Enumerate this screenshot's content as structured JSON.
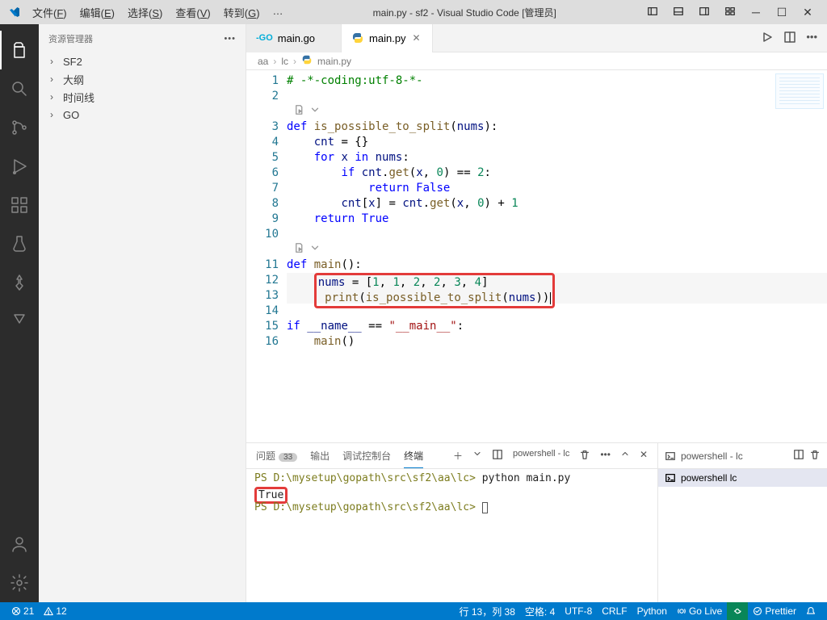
{
  "titlebar": {
    "menus": [
      "文件(F)",
      "编辑(E)",
      "选择(S)",
      "查看(V)",
      "转到(G)"
    ],
    "title": "main.py - sf2 - Visual Studio Code [管理员]"
  },
  "sidebar": {
    "title": "资源管理器",
    "items": [
      "SF2",
      "大纲",
      "时间线",
      "GO"
    ]
  },
  "tabs": [
    {
      "icon": "go",
      "label": "main.go",
      "active": false
    },
    {
      "icon": "py",
      "label": "main.py",
      "active": true
    }
  ],
  "breadcrumb": [
    "aa",
    "lc",
    "main.py"
  ],
  "code": {
    "lines": [
      {
        "n": 1,
        "html": "<span class='cm'># -*-coding:utf-8-*-</span>"
      },
      {
        "n": 2,
        "html": ""
      },
      {
        "n": "",
        "html": "<span class='lens'><svg viewBox='0 0 16 16'><path d='M2 2h6l2 2v10H2z'/><path d='M6 8l3 2-3 2z' fill='currentColor'/></svg><svg viewBox='0 0 16 16'><path d='M4 6l4 4 4-4'/></svg></span>"
      },
      {
        "n": 3,
        "html": "<span class='kw'>def</span> <span class='fn'>is_possible_to_split</span>(<span class='vr'>nums</span>):"
      },
      {
        "n": 4,
        "html": "    <span class='vr'>cnt</span> = {}"
      },
      {
        "n": 5,
        "html": "    <span class='kw'>for</span> <span class='vr'>x</span> <span class='kw'>in</span> <span class='vr'>nums</span>:"
      },
      {
        "n": 6,
        "html": "        <span class='kw'>if</span> <span class='vr'>cnt</span>.<span class='fn'>get</span>(<span class='vr'>x</span>, <span class='num'>0</span>) == <span class='num'>2</span>:"
      },
      {
        "n": 7,
        "html": "            <span class='kw'>return</span> <span class='cn'>False</span>"
      },
      {
        "n": 8,
        "html": "        <span class='vr'>cnt</span>[<span class='vr'>x</span>] = <span class='vr'>cnt</span>.<span class='fn'>get</span>(<span class='vr'>x</span>, <span class='num'>0</span>) + <span class='num'>1</span>"
      },
      {
        "n": 9,
        "html": "    <span class='kw'>return</span> <span class='cn'>True</span>"
      },
      {
        "n": 10,
        "html": ""
      },
      {
        "n": "",
        "html": "<span class='lens'><svg viewBox='0 0 16 16'><path d='M2 2h6l2 2v10H2z'/><path d='M6 8l3 2-3 2z' fill='currentColor'/></svg><svg viewBox='0 0 16 16'><path d='M4 6l4 4 4-4'/></svg></span>"
      },
      {
        "n": 11,
        "html": "<span class='kw'>def</span> <span class='fn'>main</span>():"
      },
      {
        "n": 12,
        "html": "    <span class='redbox'><span class='vr'>nums</span> = [<span class='num'>1</span>, <span class='num'>1</span>, <span class='num'>2</span>, <span class='num'>2</span>, <span class='num'>3</span>, <span class='num'>4</span>]&nbsp;&nbsp;&nbsp;&nbsp;&nbsp;&nbsp;&nbsp;&nbsp;<br>&nbsp;<span class='fn'>print</span>(<span class='fn'>is_possible_to_split</span>(<span class='vr'>nums</span>))<span class='cursor-caret'></span></span>",
        "cls": "hl-line",
        "n2": 13
      },
      {
        "n": 14,
        "html": ""
      },
      {
        "n": 15,
        "html": "<span class='kw'>if</span> <span class='vr'>__name__</span> == <span class='str'>\"__main__\"</span>:"
      },
      {
        "n": 16,
        "html": "    <span class='fn'>main</span>()"
      }
    ]
  },
  "panel": {
    "tabs": [
      {
        "label": "问题",
        "badge": "33"
      },
      {
        "label": "输出"
      },
      {
        "label": "调试控制台"
      },
      {
        "label": "终端",
        "active": true
      }
    ],
    "terminal_group_label": "powershell - lc",
    "terminal_entry": "powershell  lc",
    "terminal": [
      {
        "html": "<span class='path'>PS D:\\mysetup\\gopath\\src\\sf2\\aa\\lc&gt;</span> python main.py"
      },
      {
        "html": "<span class='redbox'>True</span>"
      },
      {
        "html": "<span class='path'>PS D:\\mysetup\\gopath\\src\\sf2\\aa\\lc&gt;</span> <span style='display:inline-block;width:7px;height:14px;border:1px solid #555;vertical-align:middle'></span>"
      }
    ]
  },
  "status": {
    "errors": "21",
    "warnings": "12",
    "cursor": "行 13，列 38",
    "spaces": "空格: 4",
    "encoding": "UTF-8",
    "eol": "CRLF",
    "lang": "Python",
    "golive": "Go Live",
    "prettier": "Prettier"
  }
}
